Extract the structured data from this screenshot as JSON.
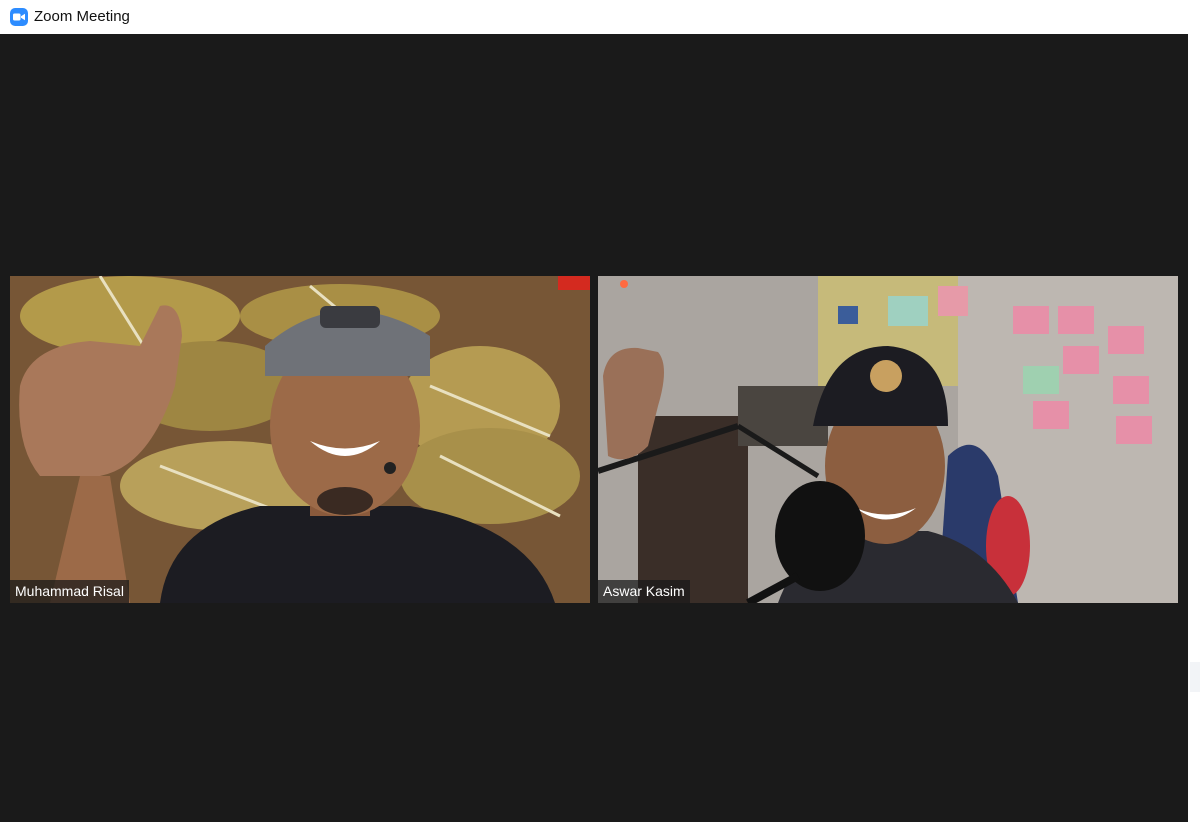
{
  "window": {
    "title": "Zoom Meeting",
    "icon": "zoom-camera-icon",
    "accent_color": "#2d8cff",
    "stage_color": "#1a1a1a"
  },
  "participants": [
    {
      "name": "Muhammad Risal"
    },
    {
      "name": "Aswar Kasim"
    }
  ]
}
